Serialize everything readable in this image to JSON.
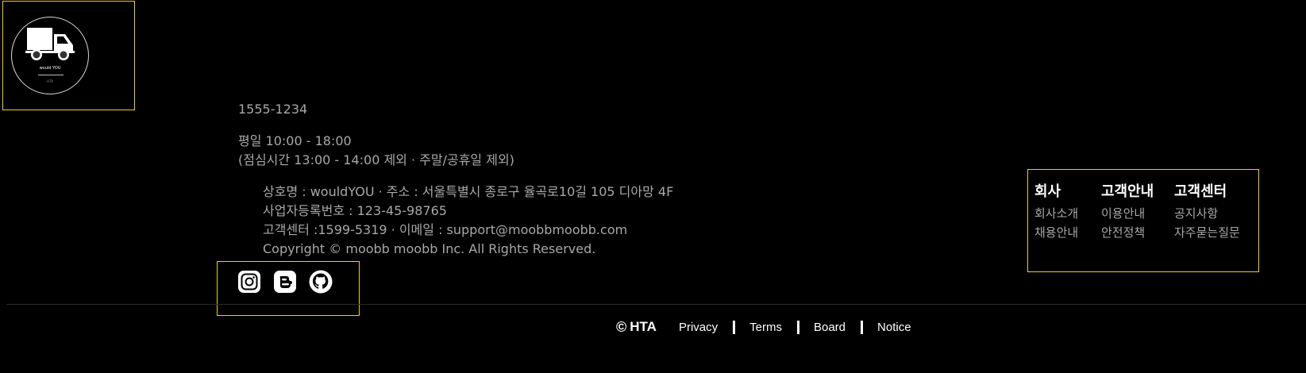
{
  "logo": {
    "text": "would YOU",
    "sub": "HTA"
  },
  "contact": {
    "phone": "1555-1234",
    "hours": "평일 10:00 - 18:00",
    "hours_note": "(점심시간 13:00 - 14:00 제외 · 주말/공휴일 제외)"
  },
  "company": {
    "line1": "상호명 : wouldYOU · 주소 : 서울특별시 종로구 율곡로10길 105 디아망 4F",
    "line2": "사업자등록번호 : 123-45-98765",
    "line3": "고객센터 :1599-5319 · 이메일 : support@moobbmoobb.com",
    "copyright": "Copyright © moobb moobb Inc. All Rights Reserved."
  },
  "social": {
    "instagram_icon": "instagram-icon",
    "blogger_icon": "blogger-icon",
    "github_icon": "github-icon"
  },
  "bottom": {
    "copyright_symbol": "©",
    "brand": "HTA",
    "links": [
      "Privacy",
      "Terms",
      "Board",
      "Notice"
    ]
  },
  "link_columns": [
    {
      "title": "회사",
      "items": [
        "회사소개",
        "채용안내"
      ]
    },
    {
      "title": "고객안내",
      "items": [
        "이용안내",
        "안전정책"
      ]
    },
    {
      "title": "고객센터",
      "items": [
        "공지사항",
        "자주묻는질문"
      ]
    }
  ],
  "colors": {
    "background": "#000000",
    "highlight_border": "#e8d21d",
    "text_muted": "#a8a8a8",
    "text_strong": "#ffffff"
  }
}
